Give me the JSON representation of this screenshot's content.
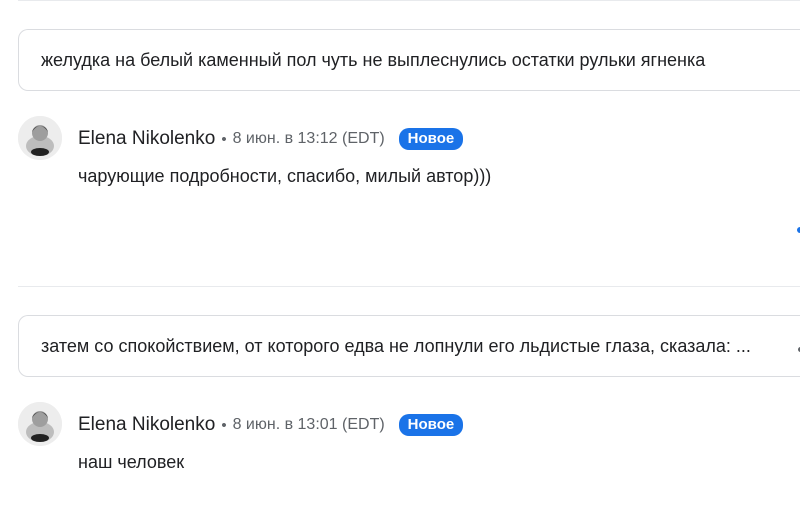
{
  "quotes": [
    {
      "text": "желудка на белый каменный пол чуть не выплеснулись остатки рульки ягненка"
    },
    {
      "text": "затем со спокойствием, от которого едва не лопнули его льдистые глаза, сказала: ..."
    }
  ],
  "comments": [
    {
      "author": "Elena Nikolenko",
      "separator": "•",
      "timestamp": "8 июн. в 13:12 (EDT)",
      "badge": "Новое",
      "text": "чарующие подробности, спасибо, милый автор)))"
    },
    {
      "author": "Elena Nikolenko",
      "separator": "•",
      "timestamp": "8 июн. в 13:01 (EDT)",
      "badge": "Новое",
      "text": "наш человек"
    }
  ],
  "colors": {
    "badge": "#1a73e8",
    "border": "#dadce0",
    "muted_text": "#5f6368"
  }
}
